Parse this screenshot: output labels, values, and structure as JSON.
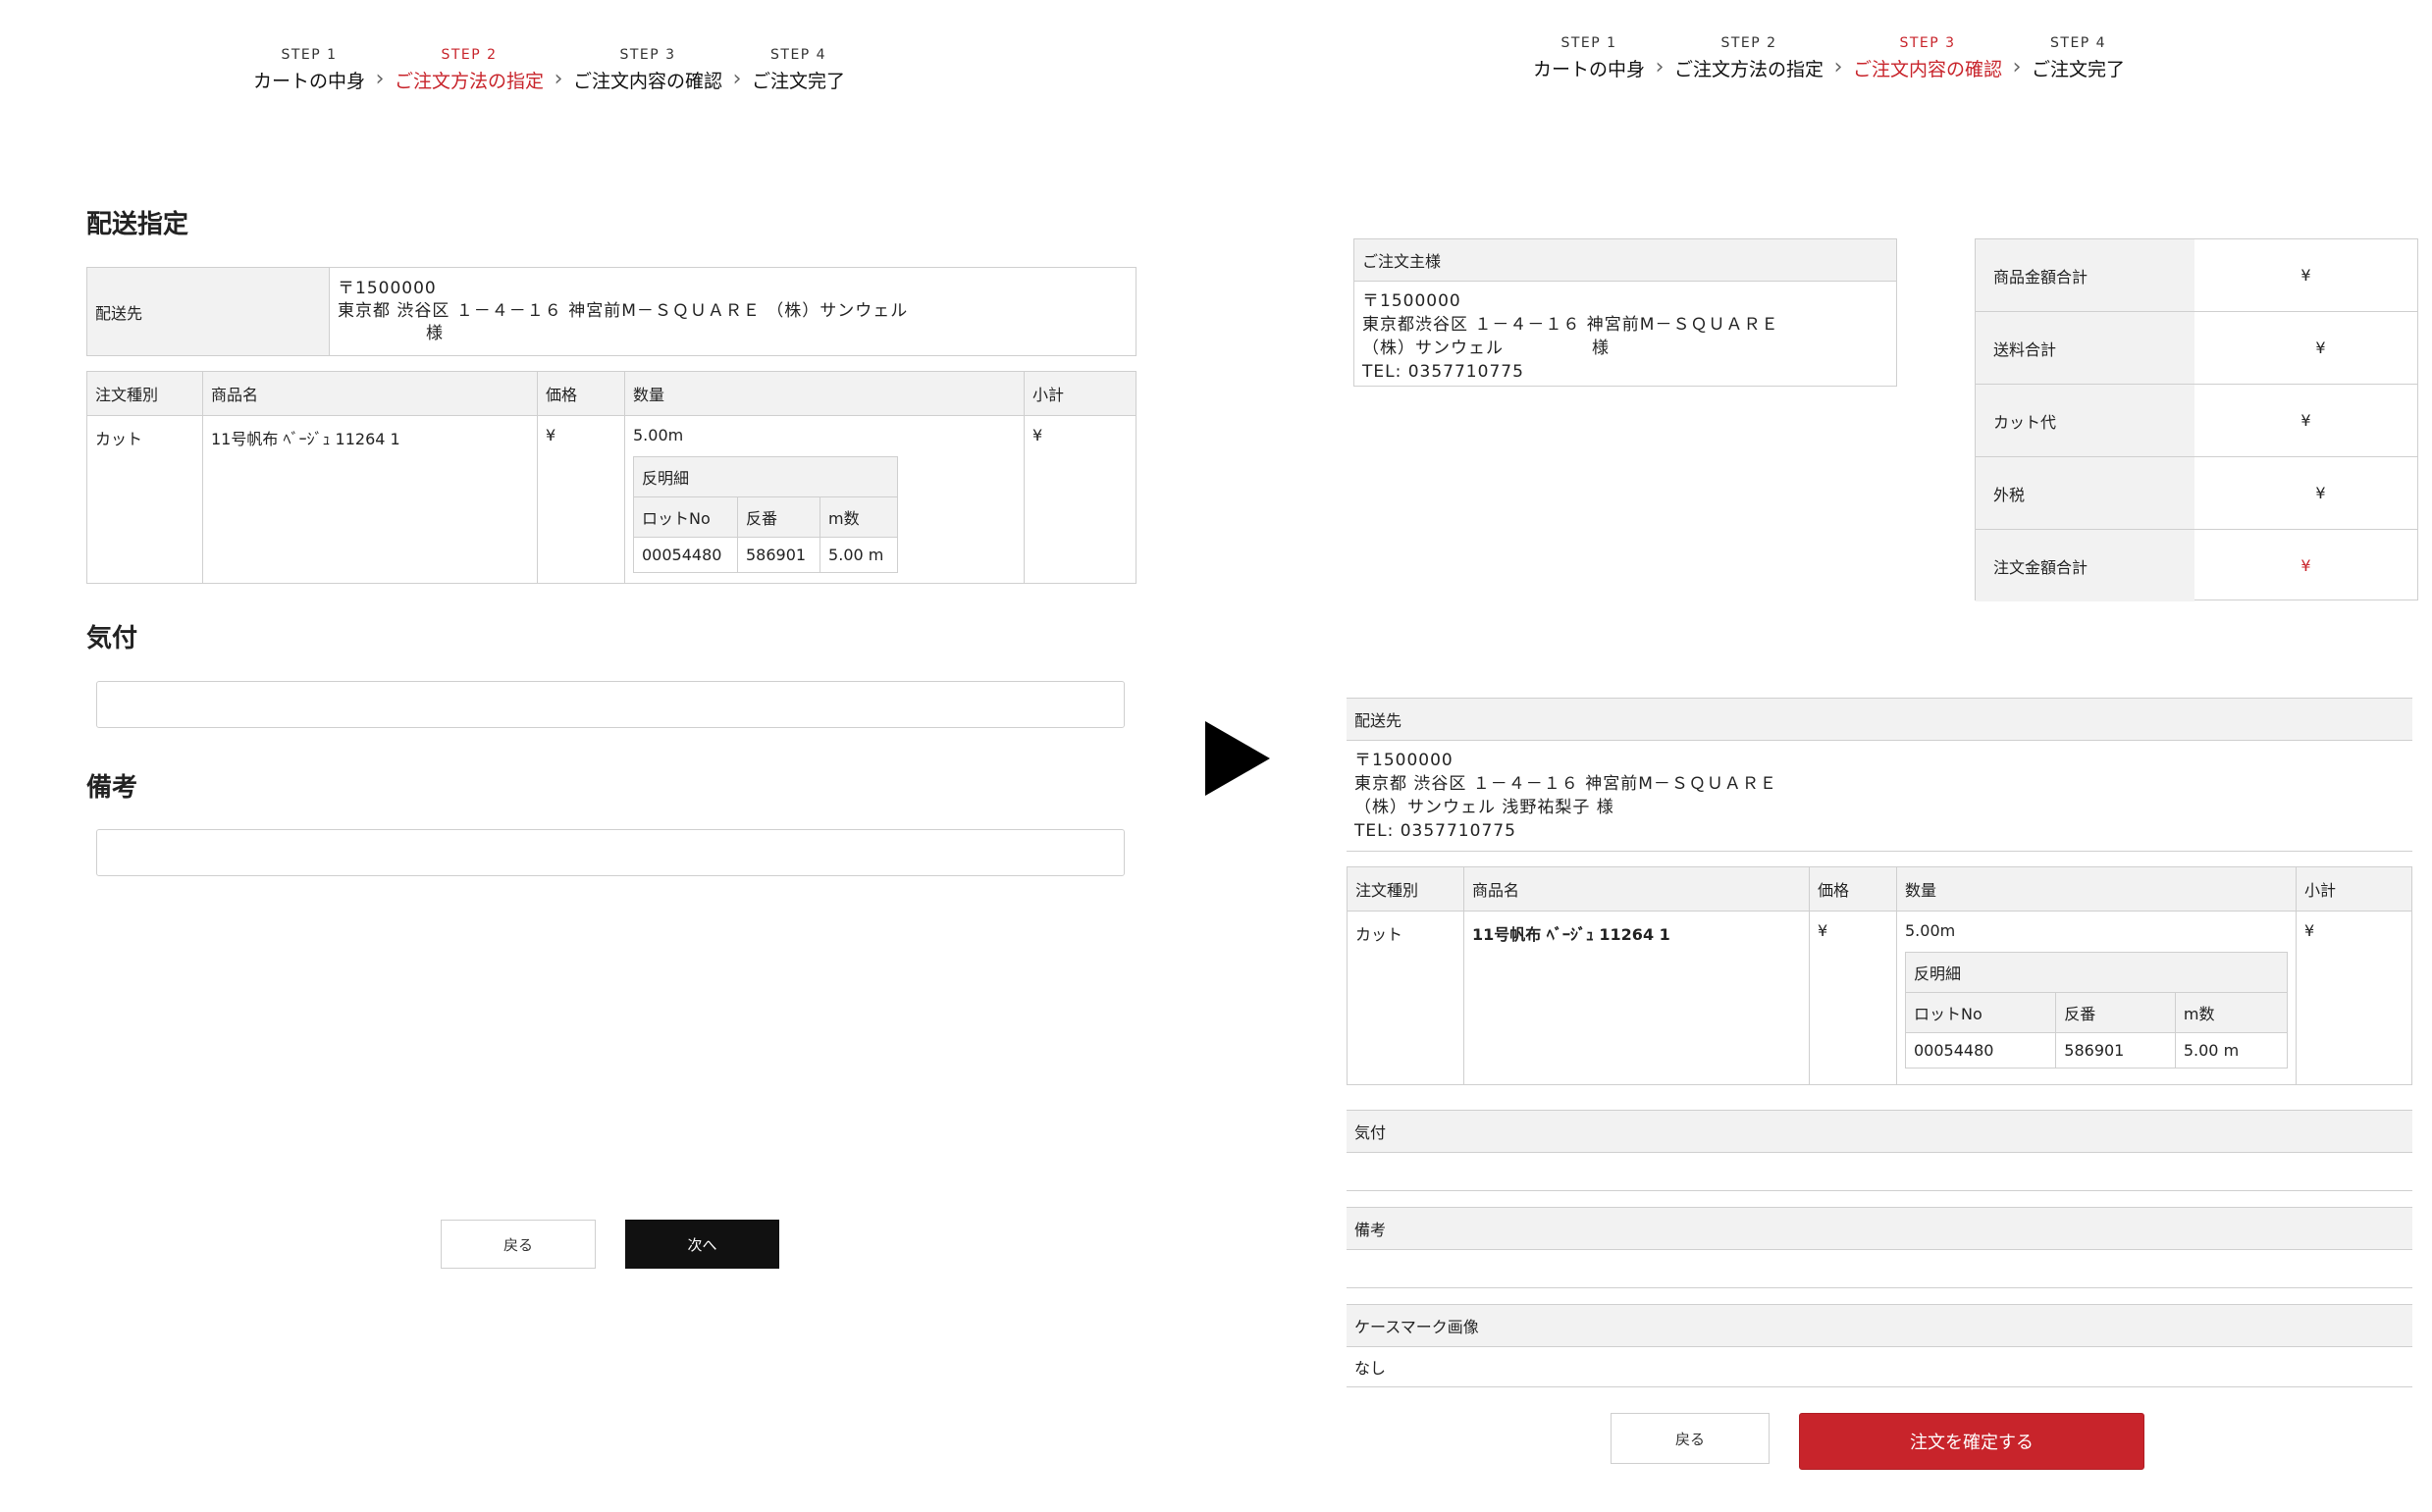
{
  "steps_left": [
    {
      "num": "STEP 1",
      "name": "カートの中身",
      "active": false
    },
    {
      "num": "STEP 2",
      "name": "ご注文方法の指定",
      "active": true
    },
    {
      "num": "STEP 3",
      "name": "ご注文内容の確認",
      "active": false
    },
    {
      "num": "STEP 4",
      "name": "ご注文完了",
      "active": false
    }
  ],
  "steps_right": [
    {
      "num": "STEP 1",
      "name": "カートの中身",
      "active": false
    },
    {
      "num": "STEP 2",
      "name": "ご注文方法の指定",
      "active": false
    },
    {
      "num": "STEP 3",
      "name": "ご注文内容の確認",
      "active": true
    },
    {
      "num": "STEP 4",
      "name": "ご注文完了",
      "active": false
    }
  ],
  "left": {
    "title": "配送指定",
    "dest_label": "配送先",
    "dest_lines": [
      "〒1500000",
      "東京都 渋谷区 １－４－１６ 神宮前M－ＳＱＵＡＲＥ （株）サンウェル"
    ],
    "dest_sama": "様",
    "table_headers": [
      "注文種別",
      "商品名",
      "価格",
      "数量",
      "小計"
    ],
    "row": {
      "type": "カット",
      "product": "11号帆布 ﾍﾞｰｼﾞｭ 11264 1",
      "price": "¥",
      "qty": "5.00m",
      "subtotal": "¥"
    },
    "sub_title": "反明細",
    "sub_headers": [
      "ロットNo",
      "反番",
      "m数"
    ],
    "sub_row": [
      "00054480",
      "586901",
      "5.00 m"
    ],
    "kitsuke_title": "気付",
    "bikou_title": "備考",
    "back_label": "戻る",
    "next_label": "次へ"
  },
  "right": {
    "orderer_head": "ご注文主様",
    "orderer_lines": [
      "〒1500000",
      "東京都渋谷区 １－４－１６ 神宮前M－ＳＱＵＡＲＥ",
      "（株）サンウェル　　　　　様",
      "TEL: 0357710775"
    ],
    "summary": [
      {
        "label": "商品金額合計",
        "value": "¥",
        "red": false
      },
      {
        "label": "送料合計",
        "value": "¥",
        "red": false
      },
      {
        "label": "カット代",
        "value": "¥",
        "red": false
      },
      {
        "label": "外税",
        "value": "¥",
        "red": false
      },
      {
        "label": "注文金額合計",
        "value": "¥",
        "red": true
      }
    ],
    "dest_head": "配送先",
    "dest_lines": [
      "〒1500000",
      "東京都 渋谷区 １－４－１６ 神宮前M－ＳＱＵＡＲＥ",
      "（株）サンウェル 浅野祐梨子 様",
      "TEL: 0357710775"
    ],
    "table_headers": [
      "注文種別",
      "商品名",
      "価格",
      "数量",
      "小計"
    ],
    "row": {
      "type": "カット",
      "product": "11号帆布 ﾍﾞｰｼﾞｭ 11264 1",
      "price": "¥",
      "qty": "5.00m",
      "subtotal": "¥"
    },
    "sub_title": "反明細",
    "sub_headers": [
      "ロットNo",
      "反番",
      "m数"
    ],
    "sub_row": [
      "00054480",
      "586901",
      "5.00 m"
    ],
    "kitsuke_head": "気付",
    "kitsuke_value": "",
    "bikou_head": "備考",
    "bikou_value": "",
    "casemark_head": "ケースマーク画像",
    "casemark_value": "なし",
    "back_label": "戻る",
    "confirm_label": "注文を確定する"
  },
  "colors": {
    "accent_red": "#c8242b",
    "dark_button": "#111111",
    "header_bg": "#f2f2f2",
    "border": "#cfcfcf"
  }
}
